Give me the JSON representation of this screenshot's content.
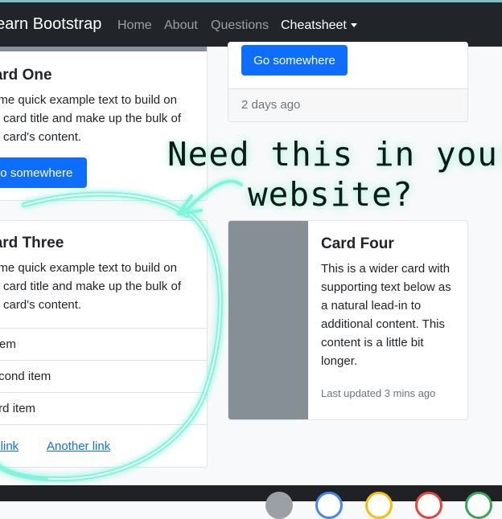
{
  "navbar": {
    "brand": "Learn Bootstrap",
    "links": [
      "Home",
      "About",
      "Questions"
    ],
    "dropdown": "Cheatsheet"
  },
  "card_one": {
    "title": "Card One",
    "text": "Some quick example text to build on the card title and make up the bulk of the card's content.",
    "button": "Go somewhere"
  },
  "card_two": {
    "button": "Go somewhere",
    "footer": "2 days ago"
  },
  "card_three": {
    "title": "Card Three",
    "text": "Some quick example text to build on the card title and make up the bulk of the card's content.",
    "items": [
      "An item",
      "A second item",
      "A third item"
    ],
    "links": [
      "Card link",
      "Another link"
    ]
  },
  "card_four": {
    "title": "Card Four",
    "text": "This is a wider card with supporting text below as a natural lead-in to additional content. This content is a little bit longer.",
    "updated": "Last updated 3 mins ago"
  },
  "overlay": {
    "line1": "Need this in your",
    "line2": "website?",
    "glow_color": "#7ff5dc"
  },
  "colors": {
    "primary": "#0d6efd",
    "navbar_bg": "#212529",
    "image_placeholder": "#868e96"
  },
  "dock_icons": [
    "settings-icon",
    "docs-icon",
    "slides-icon",
    "gmail-icon",
    "drive-icon"
  ]
}
